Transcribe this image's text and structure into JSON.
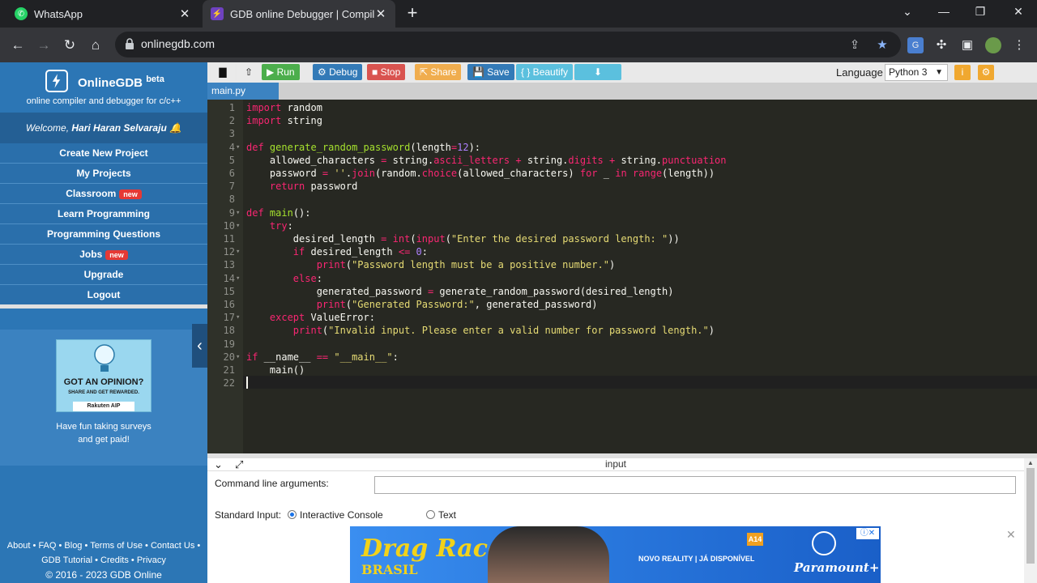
{
  "browser": {
    "tabs": [
      {
        "title": "WhatsApp",
        "favicon": "whatsapp-icon"
      },
      {
        "title": "GDB online Debugger | Compiler",
        "favicon": "gdb-icon"
      }
    ],
    "url": "onlinegdb.com"
  },
  "sidebar": {
    "brand": "OnlineGDB",
    "beta": "beta",
    "tagline": "online compiler and debugger for c/c++",
    "welcome_prefix": "Welcome, ",
    "user": "Hari Haran Selvaraju",
    "menu": [
      {
        "label": "Create New Project"
      },
      {
        "label": "My Projects"
      },
      {
        "label": "Classroom",
        "badge": "new"
      },
      {
        "label": "Learn Programming"
      },
      {
        "label": "Programming Questions"
      },
      {
        "label": "Jobs",
        "badge": "new"
      },
      {
        "label": "Upgrade"
      },
      {
        "label": "Logout"
      }
    ],
    "ad": {
      "headline": "GOT AN OPINION?",
      "sub": "SHARE AND GET REWARDED.",
      "brand": "Rakuten AIP",
      "text_line1": "Have fun taking surveys",
      "text_line2": "and get paid!"
    },
    "footer": {
      "line1": "About • FAQ • Blog • Terms of Use • Contact Us •",
      "line2": "GDB Tutorial • Credits • Privacy",
      "copyright": "© 2016 - 2023 GDB Online"
    }
  },
  "toolbar": {
    "run": "Run",
    "debug": "Debug",
    "stop": "Stop",
    "share": "Share",
    "save": "Save",
    "beautify": "{ } Beautify",
    "language_label": "Language",
    "language": "Python 3"
  },
  "file_tab": "main.py",
  "input_panel": {
    "title": "input",
    "cmd_label": "Command line arguments:",
    "stdin_label": "Standard Input:",
    "opt_console": "Interactive Console",
    "opt_text": "Text"
  },
  "banner": {
    "title": "Drag Race",
    "subtitle": "BRASIL",
    "tagline": "NOVO REALITY | JÁ DISPONÍVEL",
    "rating": "A14",
    "brand": "Paramount+"
  }
}
